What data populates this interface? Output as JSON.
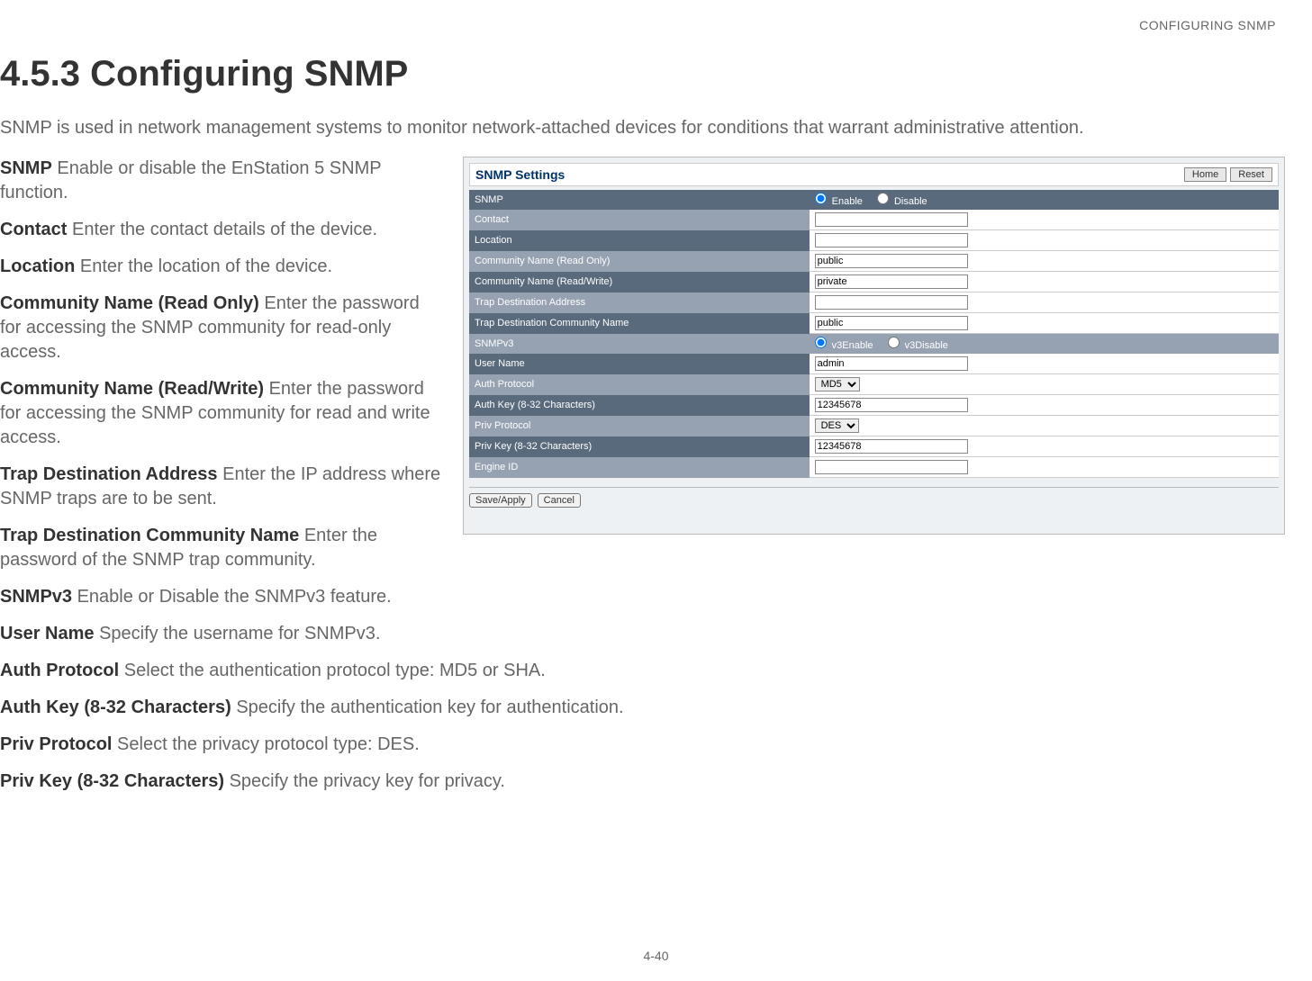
{
  "header": {
    "right": "CONFIGURING SNMP"
  },
  "title": "4.5.3 Configuring SNMP",
  "intro": "SNMP is used in network management systems to monitor network-attached devices for conditions that warrant administrative attention.",
  "defs_left": [
    {
      "term": "SNMP",
      "text": "Enable or disable the EnStation 5 SNMP function."
    },
    {
      "term": "Contact",
      "text": "Enter the contact details of the device."
    },
    {
      "term": "Location",
      "text": "Enter the location of the device."
    },
    {
      "term": "Community Name (Read Only)",
      "text": "Enter the password for accessing the SNMP community for read-only access."
    },
    {
      "term": "Community Name (Read/Write)",
      "text": "Enter the password for accessing the SNMP community for read and write access."
    },
    {
      "term": "Trap Destination Address",
      "text": "Enter the IP address where SNMP traps are to be sent."
    },
    {
      "term": "Trap Destination Community Name",
      "text": "Enter the password of the SNMP trap community."
    },
    {
      "term": "SNMPv3",
      "text": "Enable or Disable the SNMPv3 feature."
    },
    {
      "term": "User Name",
      "text": "Specify the username for SNMPv3."
    }
  ],
  "defs_full": [
    {
      "term": "Auth Protocol",
      "text": "Select the authentication protocol type: MD5 or SHA."
    },
    {
      "term": "Auth Key (8-32 Characters)",
      "text": "Specify the authentication key for authentication."
    },
    {
      "term": "Priv Protocol",
      "text": "Select the privacy protocol type: DES."
    },
    {
      "term": "Priv Key (8-32 Characters)",
      "text": "Specify the privacy key for privacy."
    }
  ],
  "panel": {
    "title": "SNMP Settings",
    "buttons": {
      "home": "Home",
      "reset": "Reset"
    },
    "rows": {
      "snmp": {
        "label": "SNMP",
        "opt1": "Enable",
        "opt2": "Disable"
      },
      "contact": {
        "label": "Contact",
        "value": ""
      },
      "location": {
        "label": "Location",
        "value": ""
      },
      "comm_ro": {
        "label": "Community Name (Read Only)",
        "value": "public"
      },
      "comm_rw": {
        "label": "Community Name (Read/Write)",
        "value": "private"
      },
      "trap_addr": {
        "label": "Trap Destination Address",
        "value": ""
      },
      "trap_comm": {
        "label": "Trap Destination Community Name",
        "value": "public"
      },
      "snmpv3": {
        "label": "SNMPv3",
        "opt1": "v3Enable",
        "opt2": "v3Disable"
      },
      "username": {
        "label": "User Name",
        "value": "admin"
      },
      "auth_proto": {
        "label": "Auth Protocol",
        "value": "MD5"
      },
      "auth_key": {
        "label": "Auth Key (8-32 Characters)",
        "value": "12345678"
      },
      "priv_proto": {
        "label": "Priv Protocol",
        "value": "DES"
      },
      "priv_key": {
        "label": "Priv Key (8-32 Characters)",
        "value": "12345678"
      },
      "engine_id": {
        "label": "Engine ID",
        "value": ""
      }
    },
    "footer": {
      "save": "Save/Apply",
      "cancel": "Cancel"
    }
  },
  "page_num": "4-40"
}
